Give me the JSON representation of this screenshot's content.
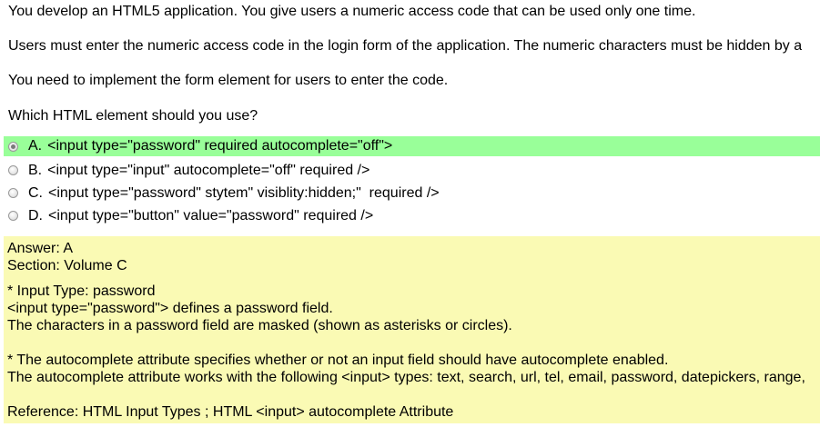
{
  "question": {
    "line1": "You develop an HTML5 application. You give users a numeric access code that can be used only one time.",
    "line2": "Users must enter the numeric access code in the login form of the application. The numeric characters must be hidden by a",
    "line3": "You need to implement the form element for users to enter the code.",
    "line4": "Which HTML element should you use?"
  },
  "options": [
    {
      "letter": "A.",
      "text": "<input type=\"password\" required autocomplete=\"off\">",
      "selected": true
    },
    {
      "letter": "B.",
      "text": "<input type=\"input\" autocomplete=\"off\" required />",
      "selected": false
    },
    {
      "letter": "C.",
      "text": "<input type=\"password\" stytem\" visiblity:hidden;\"  required />",
      "selected": false
    },
    {
      "letter": "D.",
      "text": "<input type=\"button\" value=\"password\" required />",
      "selected": false
    }
  ],
  "answer": {
    "answer_line": "Answer: A",
    "section_line": "Section: Volume C",
    "explanation1": "* Input Type: password",
    "explanation2": "<input type=\"password\"> defines a password field.",
    "explanation3": "The characters in a password field are masked (shown as asterisks or circles).",
    "explanation4": "* The autocomplete attribute specifies whether or not an input field should have autocomplete enabled.",
    "explanation5": "The autocomplete attribute works with the following <input> types: text, search, url, tel, email, password, datepickers, range,",
    "reference": "Reference: HTML Input Types ; HTML <input> autocomplete Attribute"
  },
  "colors": {
    "correct_highlight": "#99ff99",
    "answer_background": "#fafab4"
  }
}
